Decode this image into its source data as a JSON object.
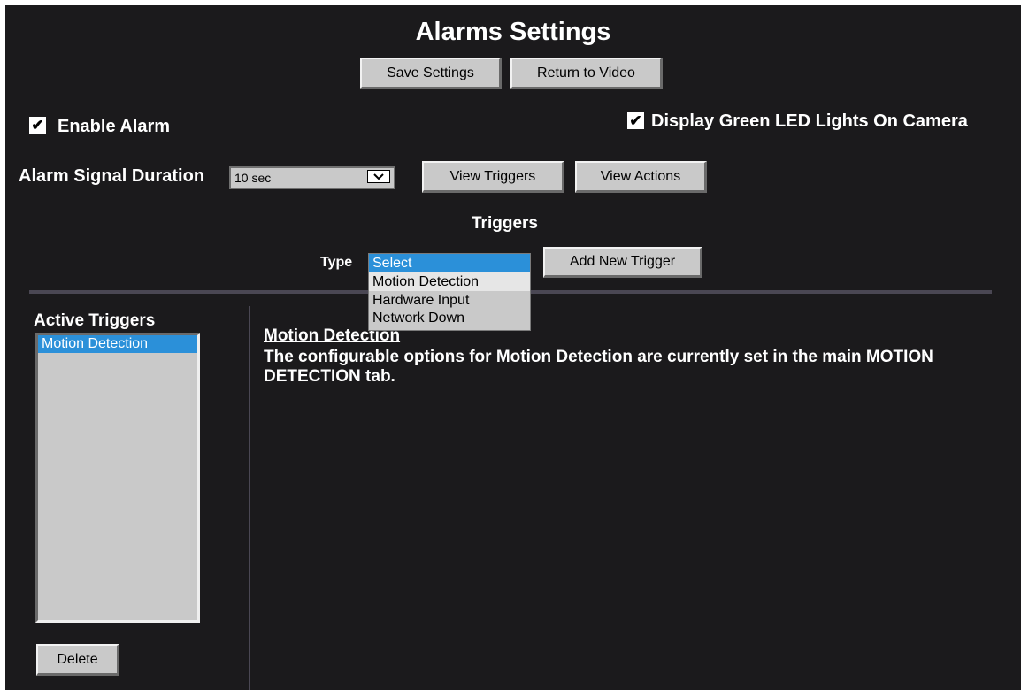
{
  "header": {
    "title": "Alarms Settings",
    "save_label": "Save Settings",
    "return_label": "Return to Video"
  },
  "options": {
    "enable_alarm_label": "Enable Alarm",
    "enable_alarm_checked": true,
    "green_led_label": "Display Green LED Lights On Camera",
    "green_led_checked": true
  },
  "duration": {
    "label": "Alarm Signal Duration",
    "value": "10 sec",
    "view_triggers_label": "View Triggers",
    "view_actions_label": "View Actions"
  },
  "triggers": {
    "heading": "Triggers",
    "type_label": "Type",
    "type_selected": "Select",
    "type_options": [
      "Select",
      "Motion Detection",
      "Hardware Input",
      "Network Down"
    ],
    "add_button_label": "Add New Trigger"
  },
  "active_triggers": {
    "heading": "Active Triggers",
    "items": [
      "Motion Detection"
    ],
    "selected_index": 0,
    "delete_label": "Delete"
  },
  "detail": {
    "title": "Motion Detection",
    "description": "The configurable options for Motion Detection are currently set in the main MOTION DETECTION tab."
  },
  "colors": {
    "background": "#1b1a1c",
    "button": "#c9c9c9",
    "selection": "#2b90d9",
    "divider": "#4a4753"
  }
}
